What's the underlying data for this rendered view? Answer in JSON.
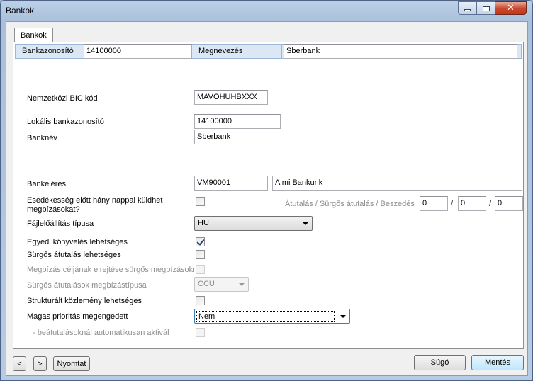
{
  "window": {
    "title": "Bankok"
  },
  "tabs": [
    {
      "label": "Bankok"
    }
  ],
  "header": {
    "code_label": "Bankazonosító",
    "code_value": "14100000",
    "name_label": "Megnevezés",
    "name_value": "Sberbank"
  },
  "form": {
    "bic_label": "Nemzetközi BIC kód",
    "bic_value": "MAVOHUHBXXX",
    "local_id_label": "Lokális bankazonosító",
    "local_id_value": "14100000",
    "bank_name_label": "Banknév",
    "bank_name_value": "Sberbank",
    "access_label": "Bankelérés",
    "access_code": "VM90001",
    "access_desc": "A mi Bankunk",
    "due_label": "Esedékesség előtt hány nappal küldhet megbízásokat?",
    "due_days_label": "Átutalás / Sürgős átutalás / Beszedés",
    "due_days": [
      "0",
      "0",
      "0"
    ],
    "due_separator": "/",
    "file_type_label": "Fájlelőállítás típusa",
    "file_type_value": "HU",
    "single_booking_label": "Egyedi könyvelés lehetséges",
    "urgent_transfer_label": "Sürgős átutalás lehetséges",
    "hide_purpose_label": "Megbízás céljának elrejtése sürgős megbízásoknál",
    "urgent_type_label": "Sürgős átutalások megbízástípusa",
    "urgent_type_value": "CCU",
    "structured_label": "Strukturált közlemény lehetséges",
    "priority_label": "Magas prioritás megengedett",
    "priority_value": "Nem",
    "auto_activate_label": "- beátutalásoknál automatikusan aktivál"
  },
  "footer": {
    "prev_label": "<",
    "next_label": ">",
    "print_label": "Nyomtat",
    "help_label": "Súgó",
    "save_label": "Mentés"
  },
  "state": {
    "single_booking_checked": true,
    "urgent_transfer_checked": false,
    "hide_purpose_checked": false,
    "structured_checked": false,
    "auto_activate_checked": false,
    "due_checked": false
  }
}
